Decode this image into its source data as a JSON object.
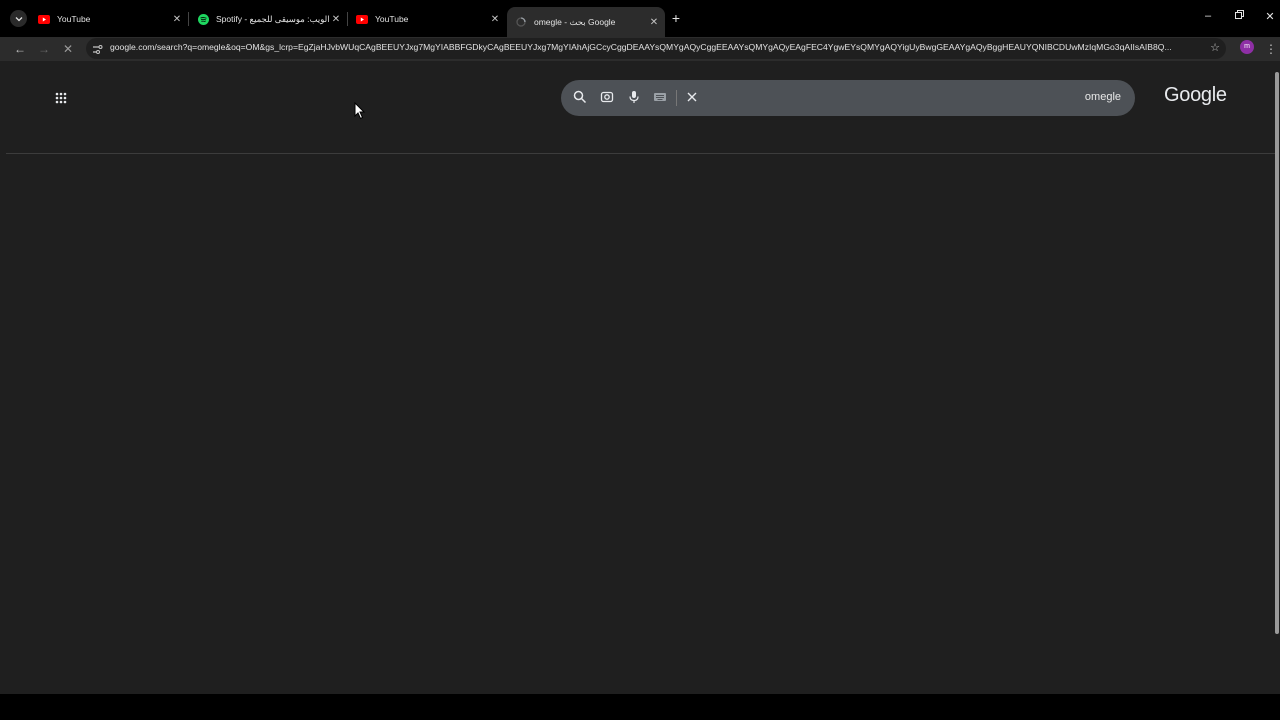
{
  "tabs": [
    {
      "title": "YouTube",
      "icon": "youtube-icon"
    },
    {
      "title": "Spotify - الويب: موسيقى للجميع",
      "icon": "spotify-icon"
    },
    {
      "title": "YouTube",
      "icon": "youtube-icon"
    },
    {
      "title": "omegle - بحث Google",
      "icon": "loading-icon"
    }
  ],
  "active_tab_index": 3,
  "toolbar": {
    "url": "google.com/search?q=omegle&oq=OM&gs_lcrp=EgZjaHJvbWUqCAgBEEUYJxg7MgYIABBFGDkyCAgBEEUYJxg7MgYIAhAjGCcyCggDEAAYsQMYgAQyCggEEAAYsQMYgAQyEAgFEC4YgwEYsQMYgAQYigUyBwgGEAAYgAQyBggHEAUYQNIBCDUwMzIqMGo3qAIIsAIB8Q..."
  },
  "search": {
    "query": "omegle"
  },
  "logo": "Google",
  "profile_initial": "m",
  "colors": {
    "youtube": "#ff0000",
    "spotify": "#1ed760",
    "profile": "#8e2fa5"
  }
}
